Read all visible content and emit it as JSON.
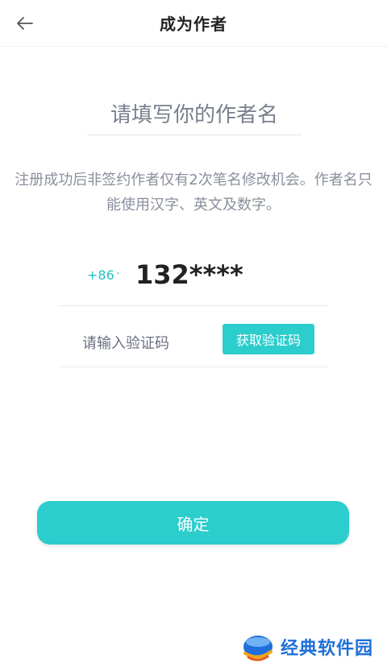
{
  "header": {
    "title": "成为作者"
  },
  "author": {
    "placeholder": "请填写你的作者名"
  },
  "description": "注册成功后非签约作者仅有2次笔名修改机会。作者名只能使用汉字、英文及数字。",
  "phone": {
    "country_code": "+86",
    "separator": "·",
    "number": "132****"
  },
  "code": {
    "placeholder": "请输入验证码",
    "button_label": "获取验证码"
  },
  "confirm_label": "确定",
  "watermark": {
    "text": "经典软件园"
  },
  "colors": {
    "accent": "#2ccdcd",
    "country_code": "#27bfc4",
    "watermark": "#1e6fd9"
  }
}
